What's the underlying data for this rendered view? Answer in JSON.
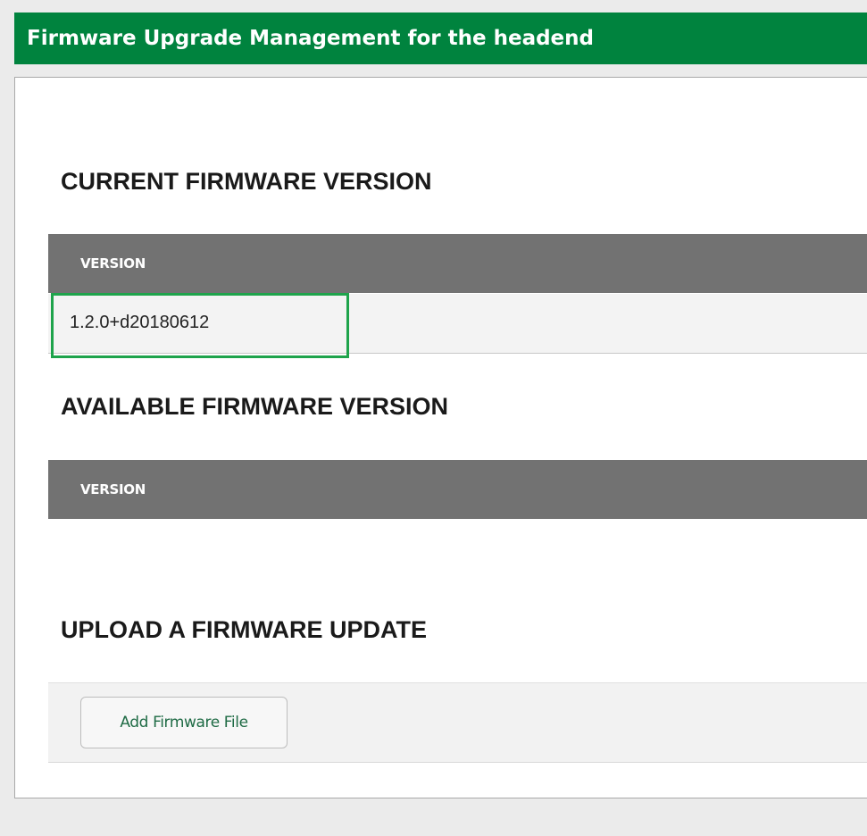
{
  "page": {
    "title": "Firmware Upgrade Management for the headend"
  },
  "current_section": {
    "heading": "CURRENT FIRMWARE VERSION",
    "column_header": "VERSION",
    "rows": [
      {
        "version": "1.2.0+d20180612"
      }
    ]
  },
  "available_section": {
    "heading": "AVAILABLE FIRMWARE VERSION",
    "column_header": "VERSION",
    "rows": []
  },
  "upload_section": {
    "heading": "UPLOAD A FIRMWARE UPDATE",
    "button_label": "Add Firmware File"
  },
  "colors": {
    "title_bar": "#00833e",
    "table_header": "#727272",
    "highlight": "#1ea34b"
  }
}
